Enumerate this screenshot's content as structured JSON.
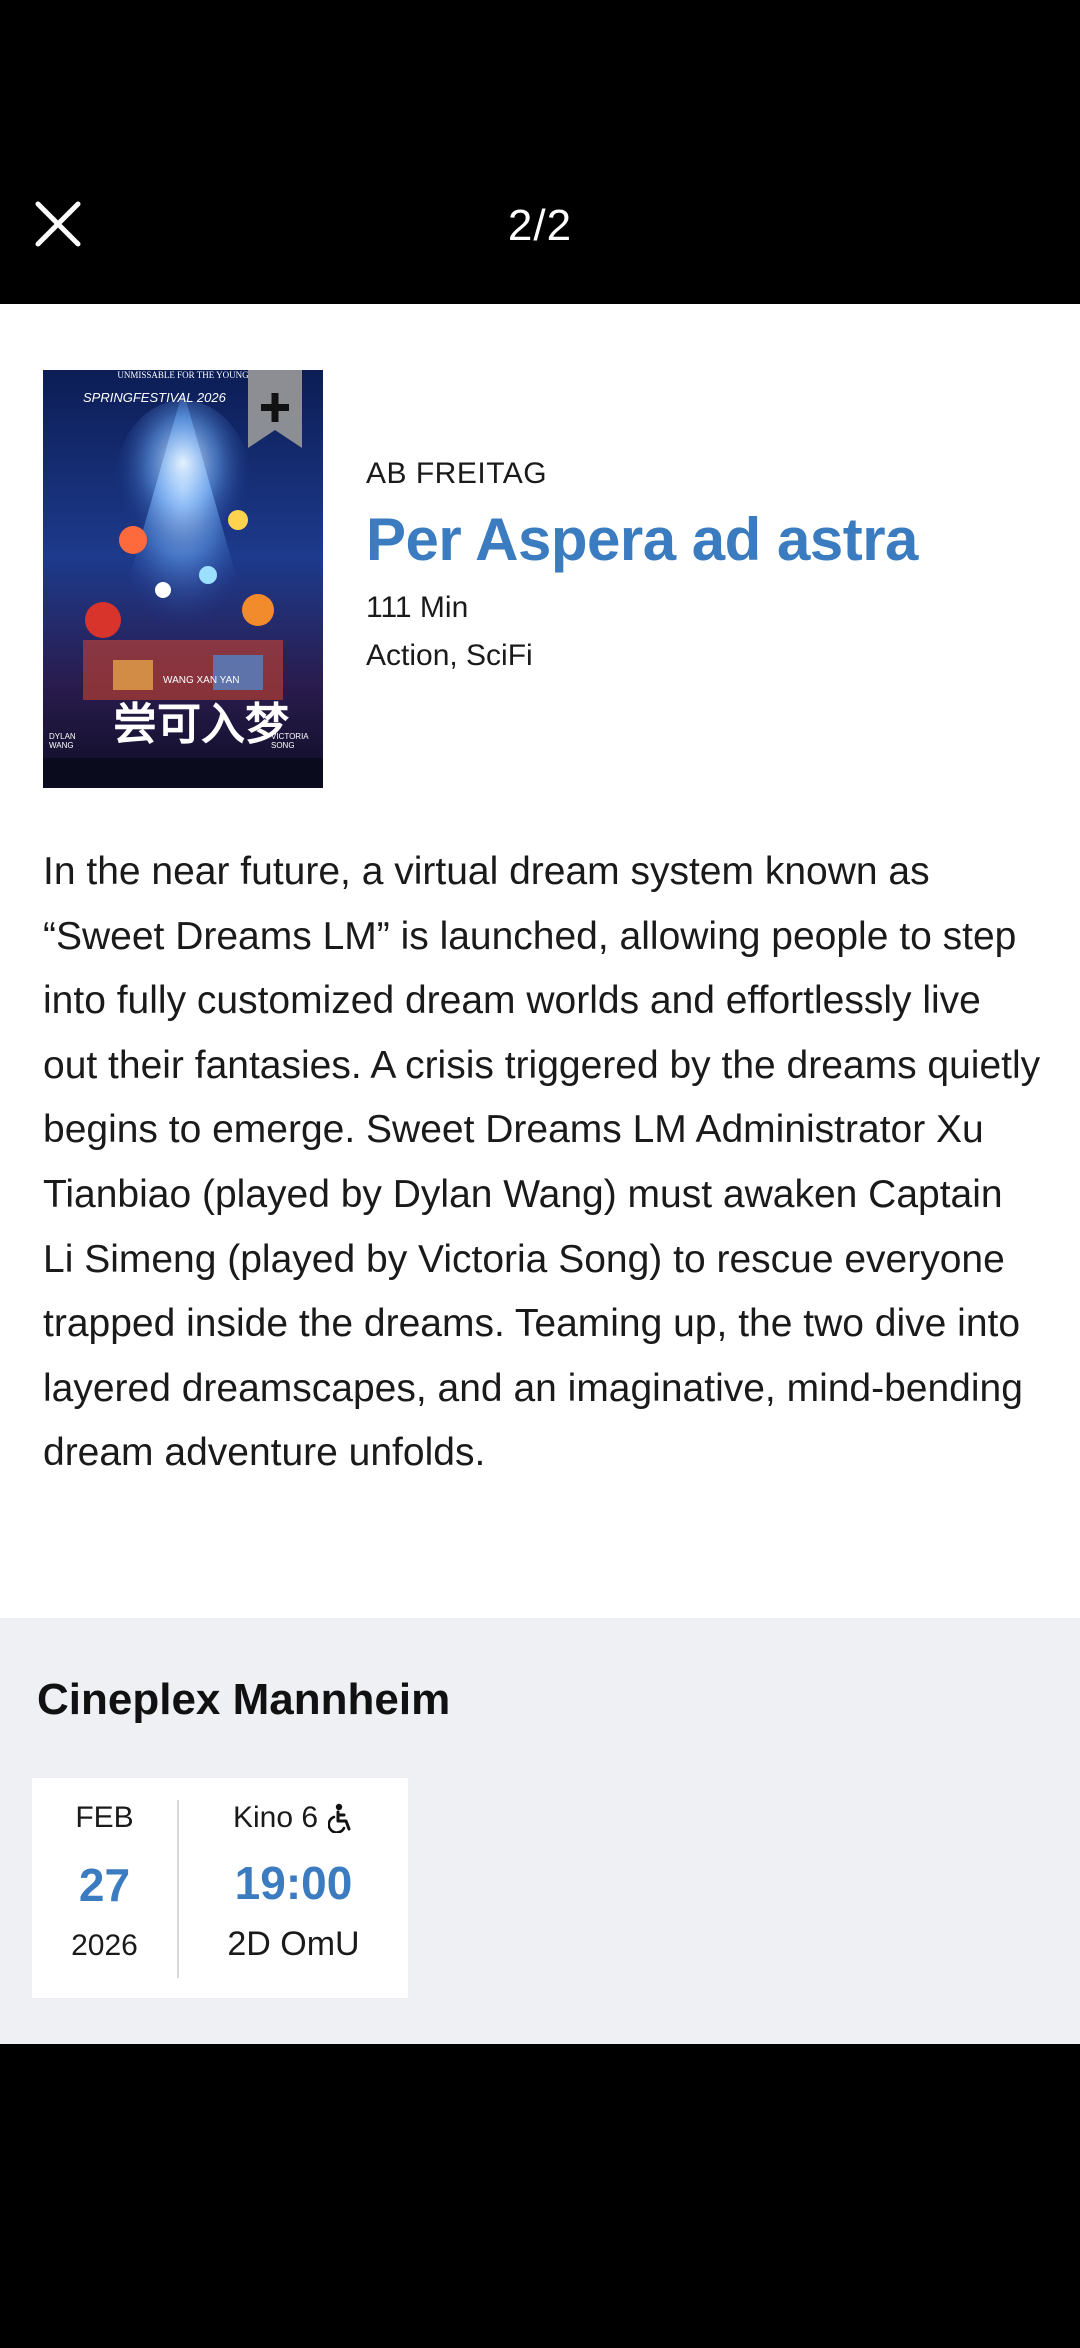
{
  "header": {
    "close_icon": "close-icon",
    "counter": "2/2"
  },
  "movie": {
    "poster": {
      "top_text": "UNMISSABLE FOR THE YOUNG",
      "festival_text": "SPRINGFESTIVAL 2026",
      "name_tag": "WANG XAN YAN",
      "title_art": "尝可入梦",
      "left_credit": "DYLAN WANG",
      "right_credit": "VICTORIA SONG"
    },
    "bookmark_icon": "plus-icon",
    "release_label": "AB FREITAG",
    "title": "Per Aspera ad astra",
    "duration": "111 Min",
    "genres": "Action, SciFi",
    "description": "In the near future, a virtual dream system known as “Sweet Dreams LM” is launched, allowing people to step into fully customized dream worlds and effortlessly live out their fantasies. A crisis triggered by the dreams quietly begins to emerge. Sweet Dreams LM Administrator Xu Tianbiao (played by Dylan Wang) must awaken Captain Li Simeng (played by Victoria Song) to rescue everyone trapped inside the dreams. Teaming up, the two dive into layered dreamscapes, and an imaginative, mind-bending dream adventure unfolds."
  },
  "showtimes": {
    "cinema": "Cineplex Mannheim",
    "shows": [
      {
        "month": "FEB",
        "day": "27",
        "year": "2026",
        "hall": "Kino 6",
        "accessibility_icon": "wheelchair-icon",
        "time": "19:00",
        "format": "2D OmU"
      }
    ]
  },
  "colors": {
    "accent": "#3b7bbf",
    "showtimes_bg": "#eef0f4"
  }
}
